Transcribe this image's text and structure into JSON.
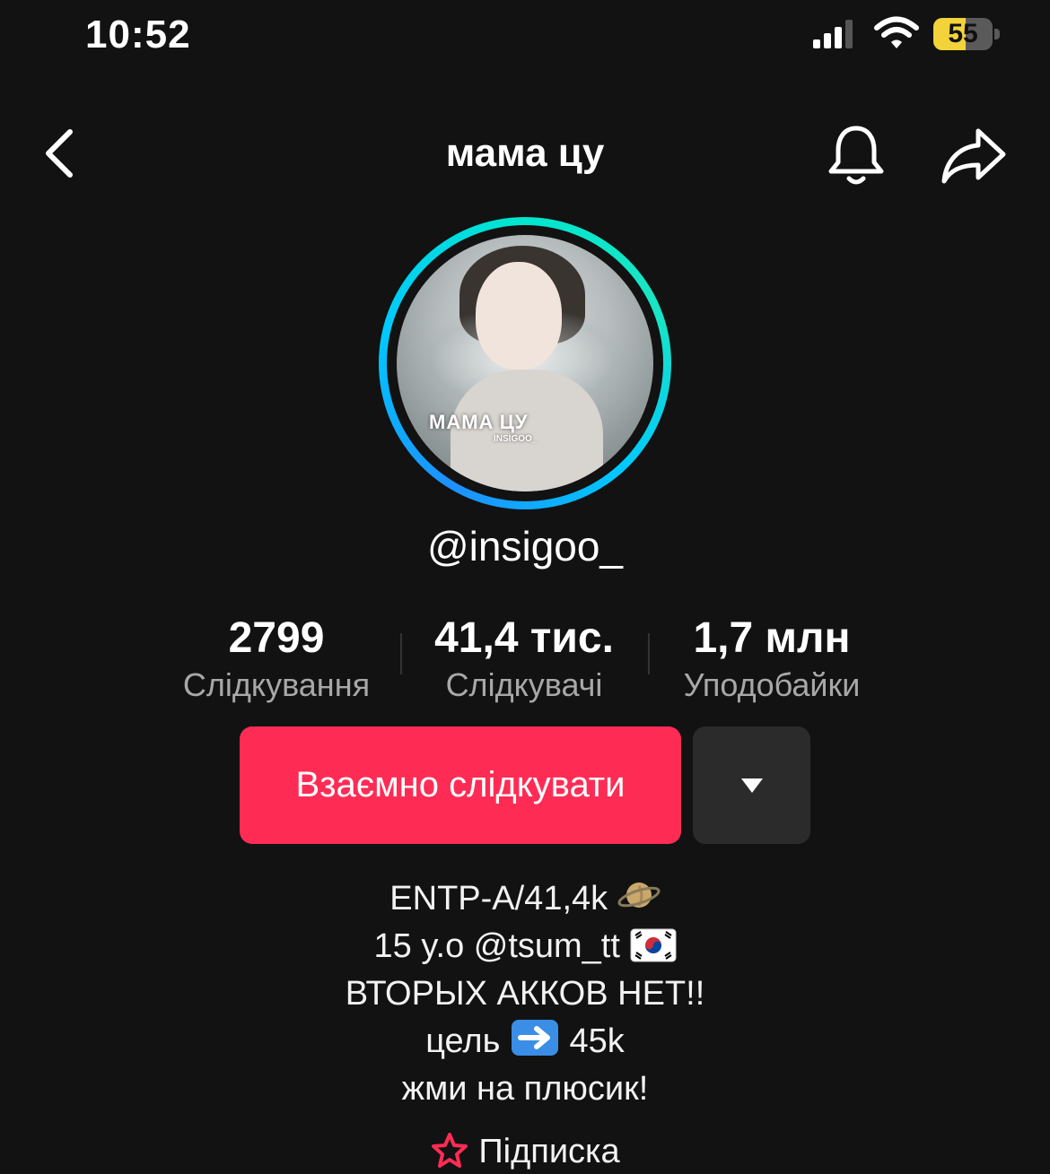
{
  "status_bar": {
    "time": "10:52",
    "battery": "55",
    "battery_level": 0.55
  },
  "header": {
    "title": "мама цу"
  },
  "avatar": {
    "overlay_title": "MAMA ЦУ",
    "overlay_subtitle": "INSIGOO_"
  },
  "profile": {
    "handle": "@insigoo_"
  },
  "stats": [
    {
      "value": "2799",
      "label": "Слідкування"
    },
    {
      "value": "41,4 тис.",
      "label": "Слідкувачі"
    },
    {
      "value": "1,7 млн",
      "label": "Уподобайки"
    }
  ],
  "actions": {
    "follow_label": "Взаємно слідкувати"
  },
  "bio": {
    "line1": "ENTP-A/41,4k",
    "line2": "15 y.o @tsum_tt",
    "line3": "ВТОРЫХ АККОВ НЕТ!!",
    "line4_a": "цель",
    "line4_b": "45k",
    "line5": "жми на плюсик!"
  },
  "subscription": {
    "label": "Підписка"
  },
  "colors": {
    "accent": "#fe2c55",
    "background": "#121212",
    "ring_start": "#1e90ff",
    "ring_end": "#19e6c3"
  },
  "icons": [
    "back-icon",
    "bell-icon",
    "share-icon",
    "chevron-down-icon",
    "planet-icon",
    "korea-flag-icon",
    "arrow-right-icon",
    "star-icon"
  ]
}
